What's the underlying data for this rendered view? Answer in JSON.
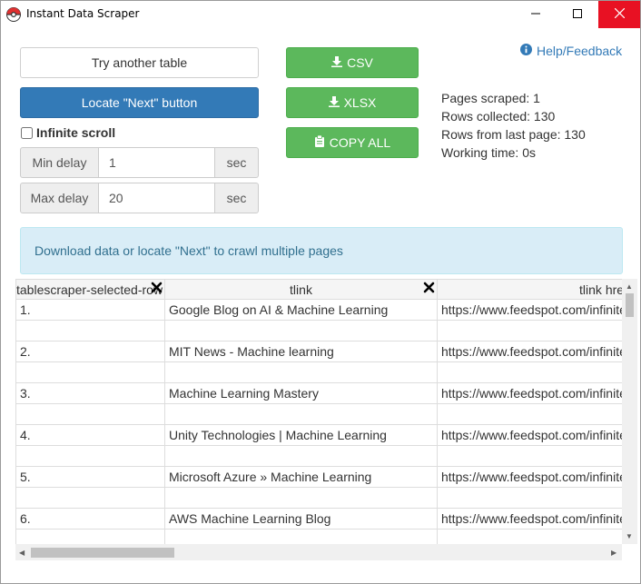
{
  "window": {
    "title": "Instant Data Scraper",
    "minimize_icon": "minimize-icon",
    "maximize_icon": "maximize-icon",
    "close_icon": "close-icon"
  },
  "controls": {
    "try_another_label": "Try another table",
    "locate_next_label": "Locate \"Next\" button",
    "csv_label": "CSV",
    "xlsx_label": "XLSX",
    "copy_all_label": "COPY ALL",
    "infinite_scroll_label": "Infinite scroll",
    "infinite_scroll_checked": false,
    "min_delay_label": "Min delay",
    "min_delay_value": "1",
    "max_delay_label": "Max delay",
    "max_delay_value": "20",
    "sec_unit": "sec"
  },
  "help": {
    "label": "Help/Feedback",
    "icon": "info-circle-icon"
  },
  "stats": {
    "pages_scraped": "Pages scraped: 1",
    "rows_collected": "Rows collected: 130",
    "rows_last_page": "Rows from last page: 130",
    "working_time": "Working time: 0s"
  },
  "alert": {
    "message": "Download data or locate \"Next\" to crawl multiple pages"
  },
  "table": {
    "headers": [
      "tablescraper-selected-row",
      "tlink",
      "tlink href"
    ],
    "rows": [
      [
        "1.",
        "Google Blog on AI & Machine Learning",
        "https://www.feedspot.com/infiniterss.php?_src=feed_title&followfeedid="
      ],
      [
        "",
        "",
        ""
      ],
      [
        "2.",
        "MIT News - Machine learning",
        "https://www.feedspot.com/infiniterss.php?_src=feed_title&followfeedid="
      ],
      [
        "",
        "",
        ""
      ],
      [
        "3.",
        "Machine Learning Mastery",
        "https://www.feedspot.com/infiniterss.php?_src=feed_title&followfeedid="
      ],
      [
        "",
        "",
        ""
      ],
      [
        "4.",
        "Unity Technologies | Machine Learning",
        "https://www.feedspot.com/infiniterss.php?_src=feed_title&followfeedid="
      ],
      [
        "",
        "",
        ""
      ],
      [
        "5.",
        "Microsoft Azure » Machine Learning",
        "https://www.feedspot.com/infiniterss.php?_src=feed_title&followfeedid="
      ],
      [
        "",
        "",
        ""
      ],
      [
        "6.",
        "AWS Machine Learning Blog",
        "https://www.feedspot.com/infiniterss.php?_src=feed_title&followfeedid="
      ],
      [
        "",
        "",
        ""
      ]
    ]
  },
  "colors": {
    "primary": "#337ab7",
    "success": "#5cb85c",
    "alert_bg": "#d9edf7",
    "alert_text": "#31708f",
    "close_hover": "#e81123"
  }
}
